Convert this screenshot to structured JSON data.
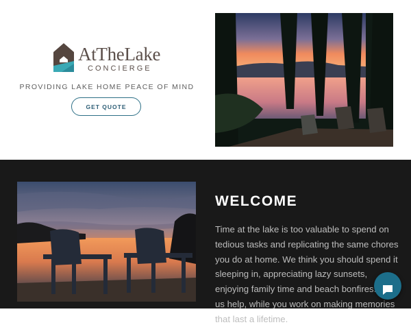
{
  "brand": {
    "name": "AtTheLake",
    "subtitle": "CONCIERGE",
    "tagline": "PROVIDING LAKE HOME PEACE OF MIND"
  },
  "hero": {
    "cta_label": "GET QUOTE"
  },
  "welcome": {
    "title": "WELCOME",
    "body": "Time at the lake is too valuable to spend on tedious tasks and replicating the same chores you do at home. We think you should spend it sleeping in, appreciating lazy sunsets, enjoying family time and beach bonfires.  Let us help, while you work on making memories that last a lifetime."
  },
  "chat": {
    "icon": "chat-bubble-icon"
  },
  "colors": {
    "accent": "#1c6e8a",
    "dark_section": "#191919",
    "logo_teal": "#3aa9b5"
  }
}
